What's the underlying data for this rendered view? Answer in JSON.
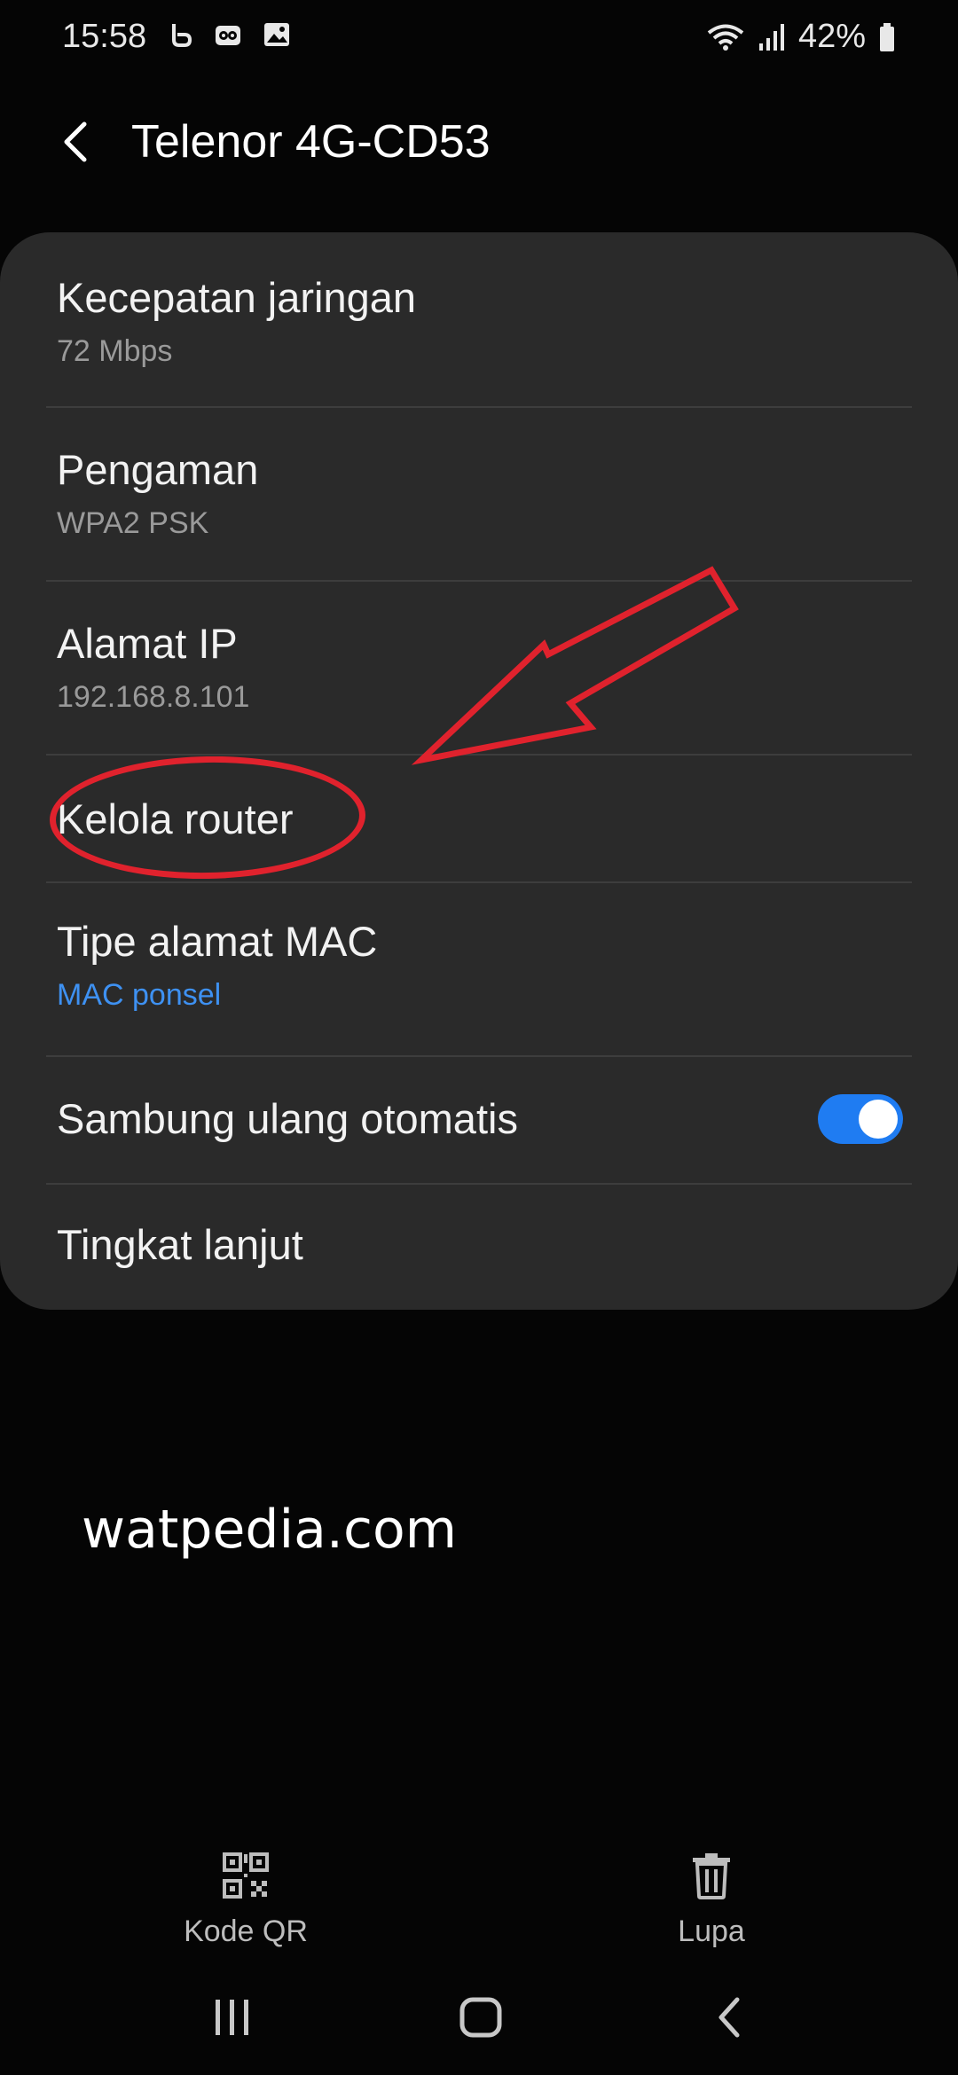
{
  "status_bar": {
    "time": "15:58",
    "left_icons": [
      "notification-app-icon",
      "camera-app-icon",
      "gallery-icon"
    ],
    "right_icons": [
      "wifi-icon",
      "signal-icon",
      "battery-icon"
    ],
    "battery_text": "42%"
  },
  "header": {
    "title": "Telenor 4G-CD53",
    "back_icon": "back-arrow-icon"
  },
  "details": [
    {
      "title": "Kecepatan jaringan",
      "subtitle": "72 Mbps"
    },
    {
      "title": "Pengaman",
      "subtitle": "WPA2 PSK"
    },
    {
      "title": "Alamat IP",
      "subtitle": "192.168.8.101"
    },
    {
      "title": "Kelola router"
    },
    {
      "title": "Tipe alamat MAC",
      "subtitle": "MAC ponsel"
    },
    {
      "title": "Sambung ulang otomatis",
      "toggle_on": true
    },
    {
      "title": "Tingkat lanjut"
    }
  ],
  "colors": {
    "background": "#050505",
    "card": "#2a2a2a",
    "accent": "#3e91f2",
    "toggle": "#1f7cf2",
    "annotation": "#e0222d"
  },
  "watermark": "watpedia.com",
  "bottom_actions": [
    {
      "label": "Kode QR",
      "icon": "qr-code-icon"
    },
    {
      "label": "Lupa",
      "icon": "trash-icon"
    }
  ],
  "nav_bar": [
    "recents-icon",
    "home-icon",
    "back-icon"
  ]
}
